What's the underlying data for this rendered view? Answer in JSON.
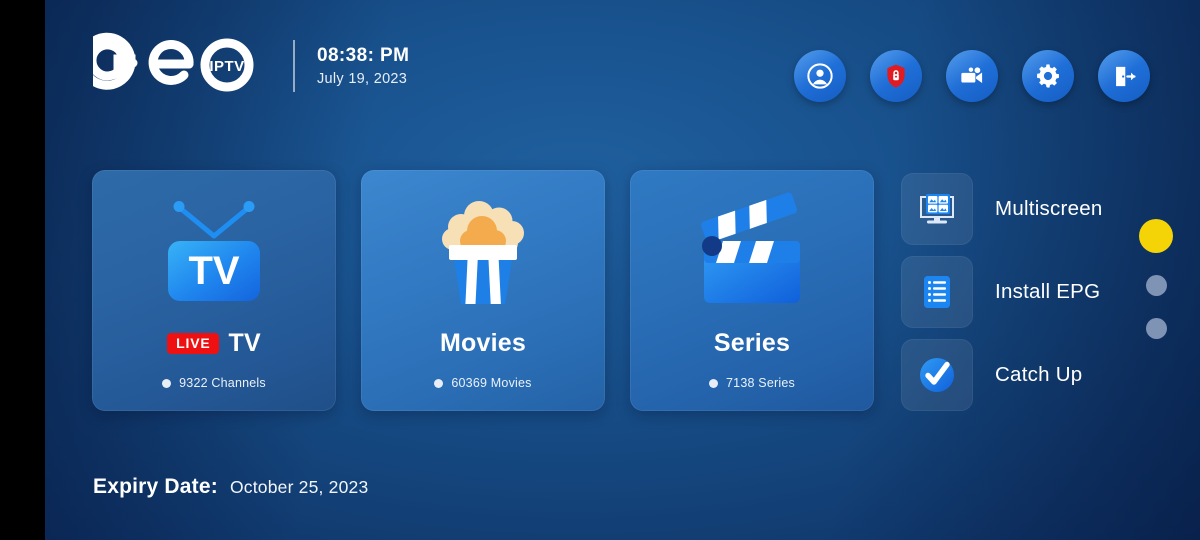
{
  "brand": {
    "name": "Geo",
    "badge": "IPTV"
  },
  "header": {
    "time": "08:38: PM",
    "date": "July  19, 2023",
    "actions": [
      {
        "name": "account-icon",
        "label": "Account"
      },
      {
        "name": "parental-lock-icon",
        "label": "Parental Control"
      },
      {
        "name": "recording-icon",
        "label": "Recordings"
      },
      {
        "name": "settings-gear-icon",
        "label": "Settings"
      },
      {
        "name": "logout-icon",
        "label": "Logout"
      }
    ]
  },
  "cards": [
    {
      "id": "live-tv",
      "icon": "tv-icon",
      "badge": "LIVE",
      "title": "TV",
      "count": "9322 Channels"
    },
    {
      "id": "movies",
      "icon": "popcorn-icon",
      "badge": "",
      "title": "Movies",
      "count": "60369 Movies"
    },
    {
      "id": "series",
      "icon": "clapperboard-icon",
      "badge": "",
      "title": "Series",
      "count": "7138 Series"
    }
  ],
  "sidebar": {
    "items": [
      {
        "id": "multiscreen",
        "icon": "multiscreen-icon",
        "label": "Multiscreen"
      },
      {
        "id": "install-epg",
        "icon": "epg-list-icon",
        "label": "Install EPG"
      },
      {
        "id": "catch-up",
        "icon": "check-circle-icon",
        "label": "Catch Up"
      }
    ]
  },
  "pager": {
    "dots": [
      {
        "active": true,
        "color": "#f4d406"
      },
      {
        "active": false,
        "color": "#7f93b5"
      },
      {
        "active": false,
        "color": "#7f93b5"
      }
    ]
  },
  "footer": {
    "expiry_label": "Expiry Date:",
    "expiry_value": "October 25, 2023"
  },
  "colors": {
    "accent_blue": "#1f6fd8",
    "active_dot": "#f4d406",
    "live_red": "#ef1111",
    "background_dark": "#082250",
    "background_light": "#1f5f9e"
  }
}
